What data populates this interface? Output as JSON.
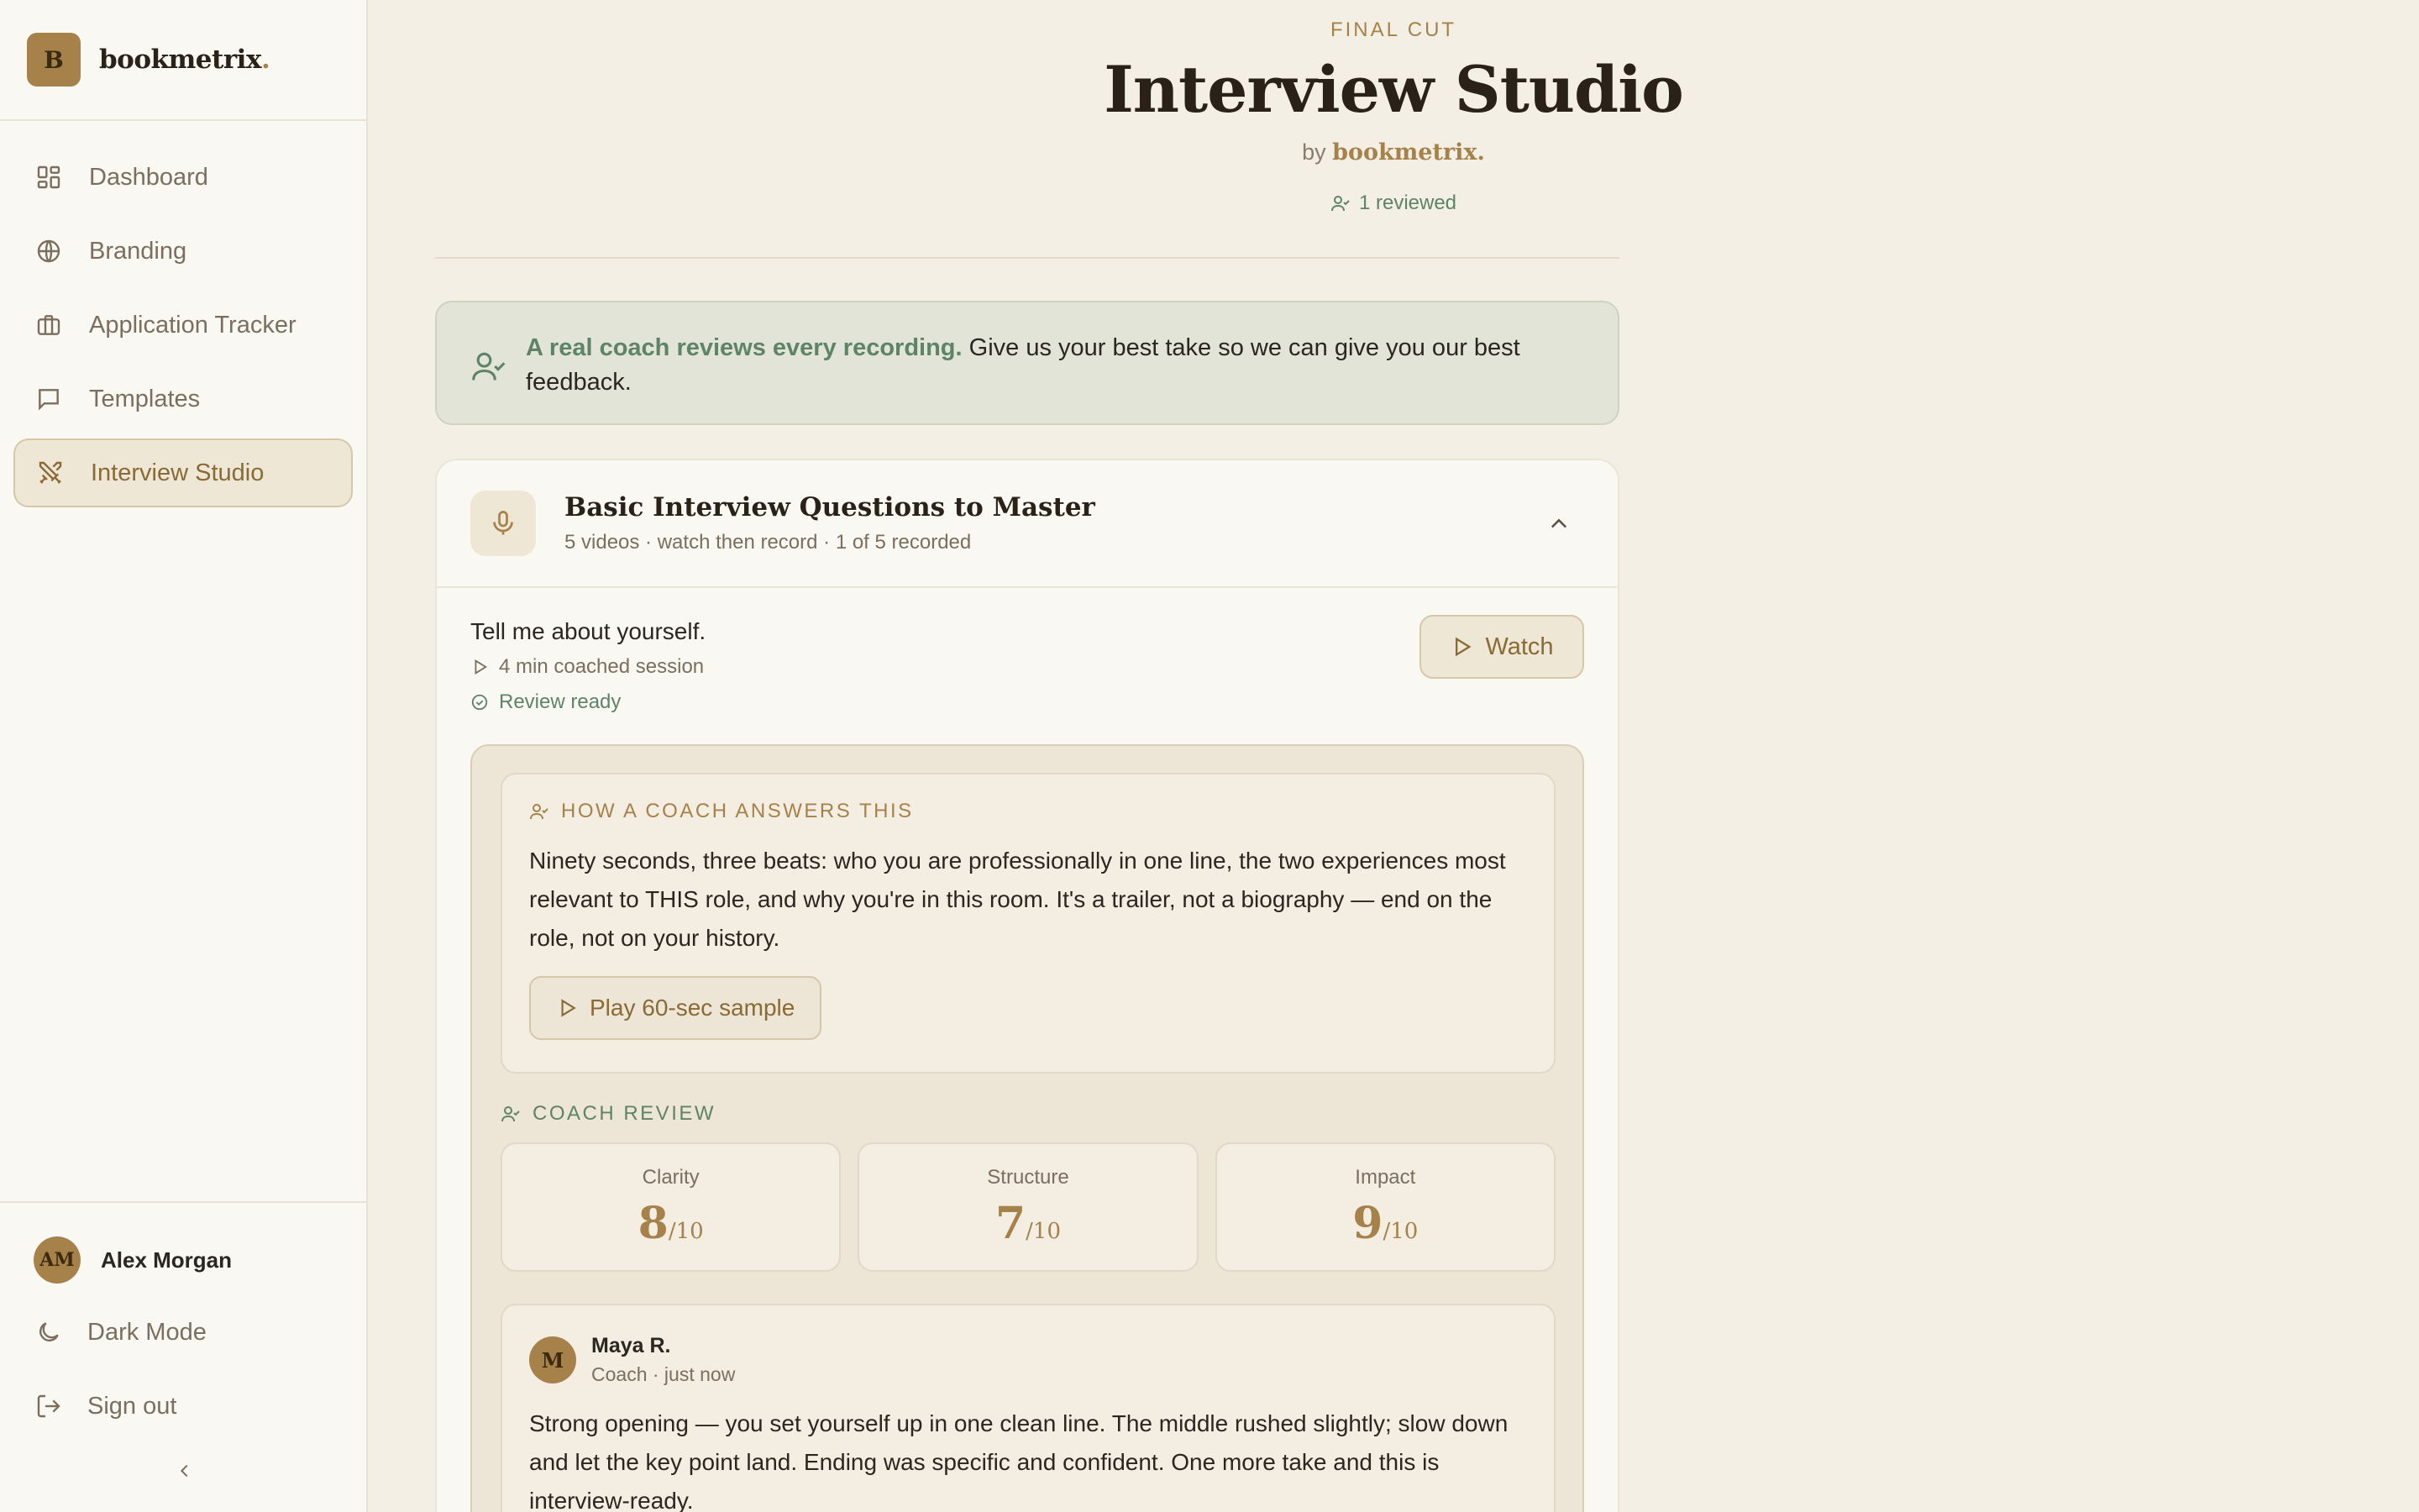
{
  "brand": {
    "logo_letter": "B",
    "name": "bookmetrix",
    "dot": "."
  },
  "sidebar": {
    "items": [
      {
        "label": "Dashboard",
        "icon": "dashboard-grid-icon",
        "active": false
      },
      {
        "label": "Branding",
        "icon": "globe-icon",
        "active": false
      },
      {
        "label": "Application Tracker",
        "icon": "briefcase-icon",
        "active": false
      },
      {
        "label": "Templates",
        "icon": "message-square-icon",
        "active": false
      },
      {
        "label": "Interview Studio",
        "icon": "swords-icon",
        "active": true
      }
    ],
    "user": {
      "initials": "AM",
      "name": "Alex Morgan"
    },
    "dark_mode_label": "Dark Mode",
    "sign_out_label": "Sign out"
  },
  "header": {
    "eyebrow": "FINAL CUT",
    "title": "Interview Studio",
    "by": "by",
    "by_brand": "bookmetrix.",
    "reviewed": "1 reviewed"
  },
  "banner": {
    "strong": "A real coach reviews every recording.",
    "text": " Give us your best take so we can give you our best feedback."
  },
  "module": {
    "title": "Basic Interview Questions to Master",
    "subtitle": "5 videos · watch then record · 1 of 5 recorded",
    "question": {
      "text": "Tell me about yourself.",
      "meta": "4 min coached session",
      "status": "Review ready",
      "watch_label": "Watch"
    },
    "coach_answer": {
      "label": "HOW A COACH ANSWERS THIS",
      "text": "Ninety seconds, three beats: who you are professionally in one line, the two experiences most relevant to THIS role, and why you're in this room. It's a trailer, not a biography — end on the role, not on your history.",
      "sample_label": "Play 60-sec sample"
    },
    "review": {
      "label": "COACH REVIEW",
      "scores": [
        {
          "name": "Clarity",
          "value": "8",
          "max": "/10"
        },
        {
          "name": "Structure",
          "value": "7",
          "max": "/10"
        },
        {
          "name": "Impact",
          "value": "9",
          "max": "/10"
        }
      ],
      "comment": {
        "initial": "M",
        "author": "Maya R.",
        "meta": "Coach · just now",
        "text": "Strong opening — you set yourself up in one clean line. The middle rushed slightly; slow down and let the key point land. Ending was specific and confident. One more take and this is interview-ready."
      }
    }
  },
  "colors": {
    "accent": "#a6824a",
    "success": "#5e8468",
    "background": "#f3efe5"
  }
}
